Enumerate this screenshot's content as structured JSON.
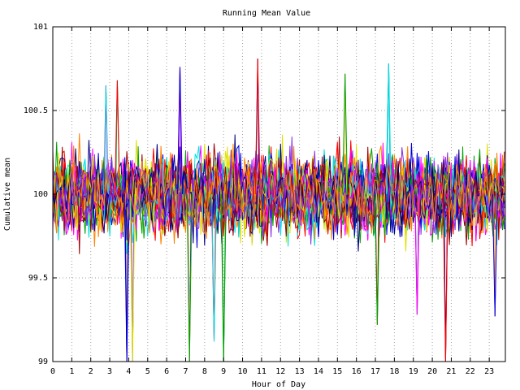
{
  "chart_data": {
    "type": "line",
    "title": "Running Mean Value",
    "xlabel": "Hour of Day",
    "ylabel": "Cumulative mean",
    "xlim": [
      0,
      23.85
    ],
    "ylim": [
      99,
      101
    ],
    "x_ticks": [
      "0",
      "1",
      "2",
      "3",
      "4",
      "5",
      "6",
      "7",
      "8",
      "9",
      "10",
      "11",
      "12",
      "13",
      "14",
      "15",
      "16",
      "17",
      "18",
      "19",
      "20",
      "21",
      "22",
      "23"
    ],
    "y_ticks": [
      "99",
      "99.5",
      "100",
      "100.5",
      "101"
    ],
    "grid": true,
    "legend": "none",
    "sample_interval_hours": 0.1,
    "center_value": 100,
    "series_count": 30,
    "colors": [
      "#ff0000",
      "#00a000",
      "#0000e0",
      "#ff00ff",
      "#00e0e0",
      "#e0e000",
      "#a00000",
      "#000080",
      "#8a2be2",
      "#ff8000"
    ],
    "notable_excursions": [
      {
        "x": 3.9,
        "y": 99.0,
        "color": "#0000e0"
      },
      {
        "x": 4.2,
        "y": 99.0,
        "color": "#e0e000"
      },
      {
        "x": 7.2,
        "y": 99.0,
        "color": "#00a000"
      },
      {
        "x": 8.5,
        "y": 99.12,
        "color": "#00e0e0"
      },
      {
        "x": 9.0,
        "y": 99.0,
        "color": "#00a000"
      },
      {
        "x": 10.8,
        "y": 100.81,
        "color": "#ff0000"
      },
      {
        "x": 6.7,
        "y": 100.76,
        "color": "#0000e0"
      },
      {
        "x": 17.7,
        "y": 100.78,
        "color": "#00e0e0"
      },
      {
        "x": 15.4,
        "y": 100.72,
        "color": "#00a000"
      },
      {
        "x": 17.1,
        "y": 99.22,
        "color": "#00a000"
      },
      {
        "x": 20.7,
        "y": 99.0,
        "color": "#ff0000"
      },
      {
        "x": 19.2,
        "y": 99.28,
        "color": "#ff00ff"
      },
      {
        "x": 23.3,
        "y": 99.27,
        "color": "#0000e0"
      },
      {
        "x": 2.8,
        "y": 100.65,
        "color": "#00e0e0"
      },
      {
        "x": 3.4,
        "y": 100.68,
        "color": "#ff0000"
      }
    ]
  }
}
